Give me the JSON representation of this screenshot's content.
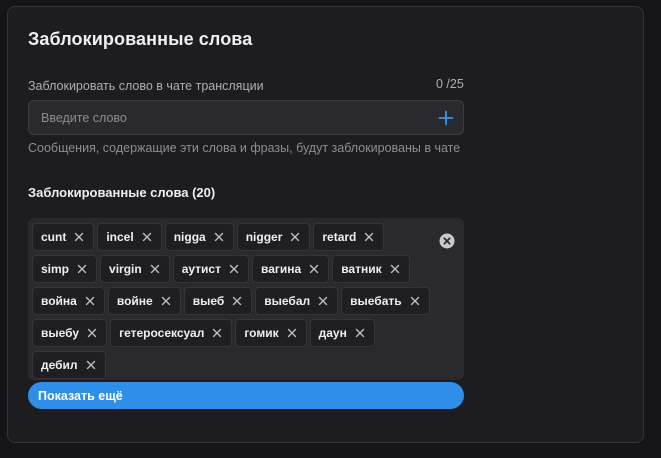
{
  "section": {
    "title": "Заблокированные слова"
  },
  "input": {
    "label": "Заблокировать слово в чате трансляции",
    "counter": "0 /25",
    "placeholder": "Введите слово",
    "value": "",
    "add_icon": "plus-icon",
    "hint": "Сообщения, содержащие эти слова и фразы, будут заблокированы в чате"
  },
  "blocked": {
    "title": "Заблокированные слова (20)",
    "remove_icon": "close-icon",
    "clear_all_icon": "clear-circle-icon",
    "words": [
      "cunt",
      "incel",
      "nigga",
      "nigger",
      "retard",
      "simp",
      "virgin",
      "аутист",
      "вагина",
      "ватник",
      "война",
      "войне",
      "выеб",
      "выебал",
      "выебать",
      "выебу",
      "гетеросексуал",
      "гомик",
      "даун",
      "дебил"
    ]
  },
  "show_more": {
    "label": "Показать ещё"
  },
  "colors": {
    "accent": "#2f8fe8",
    "background": "#151517",
    "card": "#1d1d20",
    "field": "#2a2a2e"
  }
}
